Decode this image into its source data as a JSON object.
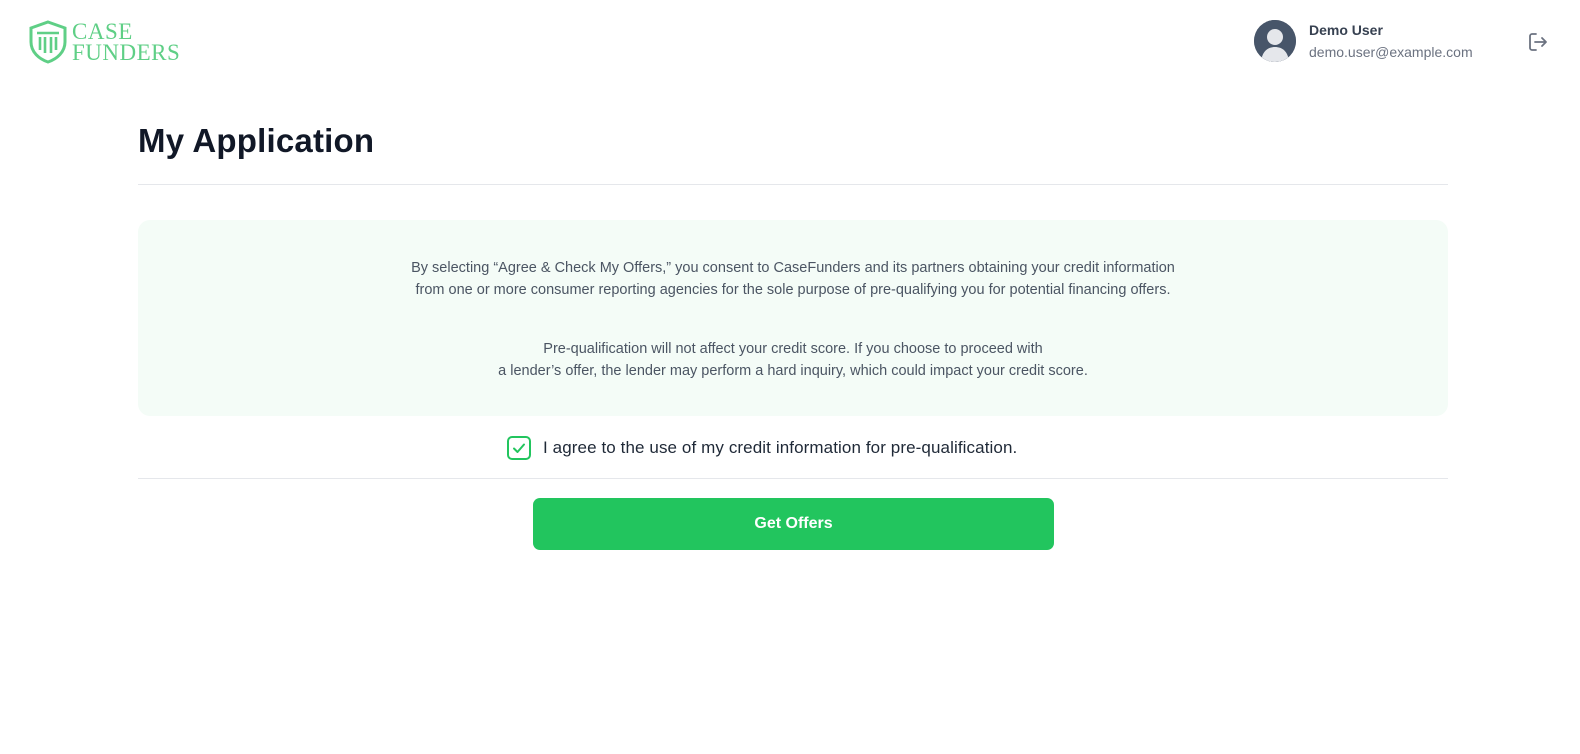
{
  "brand": {
    "line1": "CASE",
    "line2": "FUNDERS",
    "color": "#5fcf86",
    "icon": "shield-columns-icon"
  },
  "user": {
    "name": "Demo User",
    "email": "demo.user@example.com",
    "avatar_icon": "user-avatar-icon"
  },
  "header": {
    "logout_icon": "logout-icon"
  },
  "page": {
    "title": "My Application"
  },
  "consent": {
    "paragraph1": [
      "By selecting “Agree & Check My Offers,” you consent to CaseFunders and its partners obtaining your credit information",
      "from one or more consumer reporting agencies for the sole purpose of pre-qualifying you for potential financing offers."
    ],
    "paragraph2": [
      "Pre-qualification will not affect your credit score. If you choose to proceed with",
      "a lender’s offer, the lender may perform a hard inquiry, which could impact your credit score."
    ],
    "background": "#f4fcf7"
  },
  "agreement": {
    "checked": true,
    "label": "I agree to the use of my credit information for pre-qualification."
  },
  "actions": {
    "get_offers_label": "Get Offers",
    "accent": "#22c55e"
  }
}
